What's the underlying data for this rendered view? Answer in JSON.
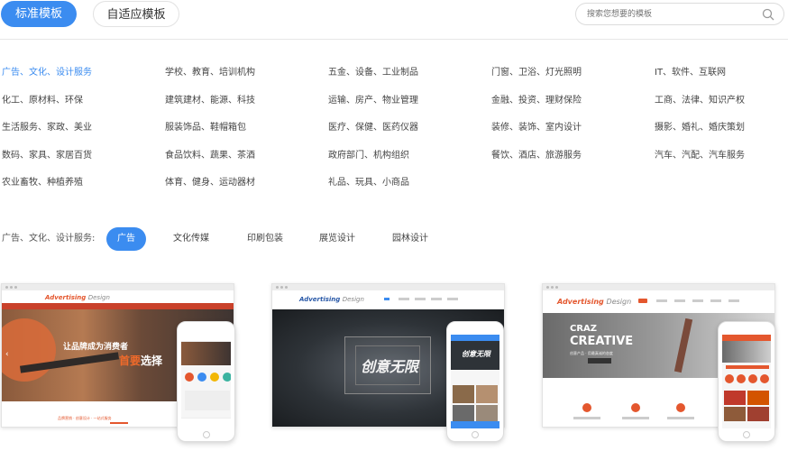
{
  "tabs": {
    "standard": "标准模板",
    "adaptive": "自适应模板"
  },
  "search": {
    "placeholder": "搜索您想要的模板"
  },
  "categories": [
    [
      "广告、文化、设计服务",
      "学校、教育、培训机构",
      "五金、设备、工业制品",
      "门窗、卫浴、灯光照明",
      "IT、软件、互联网"
    ],
    [
      "化工、原材料、环保",
      "建筑建材、能源、科技",
      "运输、房产、物业管理",
      "金融、投资、理财保险",
      "工商、法律、知识产权"
    ],
    [
      "生活服务、家政、美业",
      "服装饰品、鞋帽箱包",
      "医疗、保健、医药仪器",
      "装修、装饰、室内设计",
      "摄影、婚礼、婚庆策划"
    ],
    [
      "数码、家具、家居百货",
      "食品饮料、蔬果、茶酒",
      "政府部门、机构组织",
      "餐饮、酒店、旅游服务",
      "汽车、汽配、汽车服务"
    ],
    [
      "农业畜牧、种植养殖",
      "体育、健身、运动器材",
      "礼品、玩具、小商品",
      "",
      ""
    ]
  ],
  "selected_category": "广告、文化、设计服务",
  "subcategory": {
    "label": "广告、文化、设计服务:",
    "items": [
      "广告",
      "文化传媒",
      "印刷包装",
      "展览设计",
      "园林设计"
    ],
    "selected": "广告"
  },
  "templates": [
    {
      "logo": "Advertising",
      "logo_sub": "Design",
      "hero_line1": "让品牌成为消费者",
      "hero_highlight": "首要",
      "hero_line2": "选择",
      "footer_text": "品牌营销 · 创意设计 · 一站式服务"
    },
    {
      "logo": "Advertising",
      "logo_sub": "Design",
      "hero_title": "创意无限",
      "phone_title": "创意无限"
    },
    {
      "logo": "Advertising",
      "logo_sub": "Design",
      "hero_crazy": "CRAZ",
      "hero_creative": "CREATIVE",
      "hero_sub": "创意产品 · 用最真诚的态度"
    }
  ],
  "colors": {
    "accent": "#3b8cf0",
    "brand_red": "#e4572e"
  },
  "icons": {
    "search": "search-icon"
  }
}
